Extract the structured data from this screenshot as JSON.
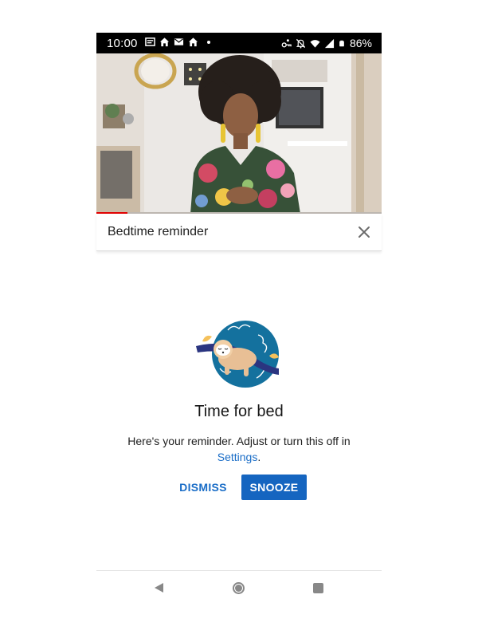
{
  "status_bar": {
    "time": "10:00",
    "battery_percent": "86%",
    "left_icons": [
      "news-icon",
      "home-icon",
      "mail-icon",
      "home-icon",
      "dot-icon"
    ],
    "right_icons": [
      "vpn-key-icon",
      "notifications-off-icon",
      "wifi-icon",
      "signal-icon",
      "battery-icon"
    ]
  },
  "video": {
    "progress": 0.11,
    "progress_color": "#e00000"
  },
  "reminder": {
    "title": "Bedtime reminder"
  },
  "content": {
    "heading": "Time for bed",
    "message_prefix": "Here's your reminder. Adjust or turn this off in ",
    "settings_link": "Settings",
    "message_suffix": ".",
    "dismiss_label": "DISMISS",
    "snooze_label": "SNOOZE",
    "accent_color": "#1565c0"
  },
  "nav": {
    "icons": [
      "back-icon",
      "home-icon",
      "recents-icon"
    ]
  }
}
